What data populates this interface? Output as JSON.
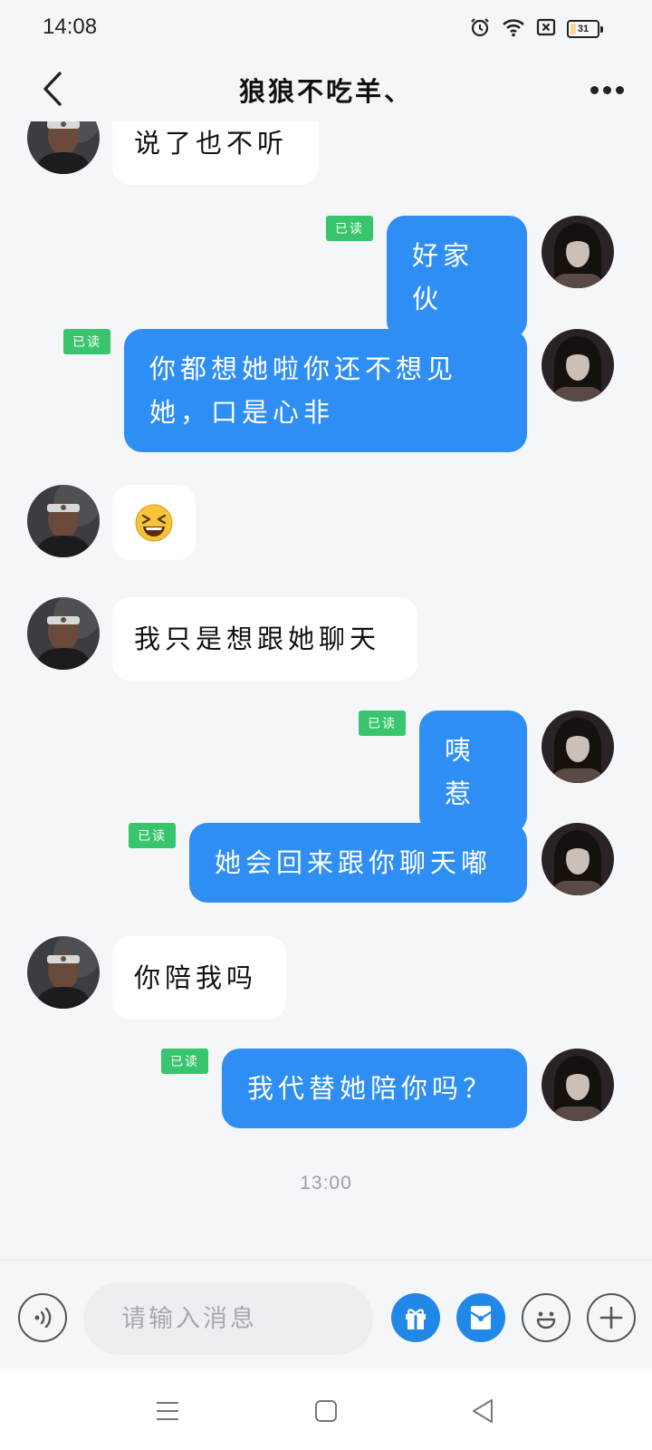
{
  "status_bar": {
    "time": "14:08",
    "battery": "31",
    "icons": [
      "alarm-icon",
      "wifi-icon",
      "sim-x-icon",
      "battery-icon"
    ]
  },
  "header": {
    "title": "狼狼不吃羊、",
    "back_icon": "chevron-left-icon",
    "more_icon": "more-dots-icon"
  },
  "messages": [
    {
      "side": "in",
      "text": "说了也不听"
    },
    {
      "side": "out",
      "text": "好家伙",
      "status": "已读"
    },
    {
      "side": "out",
      "text": "你都想她啦你还不想见她，口是心非",
      "status": "已读"
    },
    {
      "side": "in",
      "text": "😆"
    },
    {
      "side": "in",
      "text": "我只是想跟她聊天"
    },
    {
      "side": "out",
      "text": "咦惹",
      "status": "已读"
    },
    {
      "side": "out",
      "text": "她会回来跟你聊天嘟",
      "status": "已读"
    },
    {
      "side": "in",
      "text": "你陪我吗"
    },
    {
      "side": "out",
      "text": "我代替她陪你吗？",
      "status": "已读"
    }
  ],
  "timestamp": "13:00",
  "input_bar": {
    "placeholder": "请输入消息",
    "icons": [
      "voice-icon",
      "gift-icon",
      "red-packet-icon",
      "emoji-icon",
      "plus-icon"
    ]
  },
  "nav_bar": {
    "icons": [
      "menu-icon",
      "home-icon",
      "back-triangle-icon"
    ]
  },
  "colors": {
    "background": "#f4f6f9",
    "outgoing_bubble": "#2f8ef3",
    "incoming_bubble": "#ffffff",
    "read_badge": "#39c46e",
    "action_blue": "#2288e8"
  }
}
